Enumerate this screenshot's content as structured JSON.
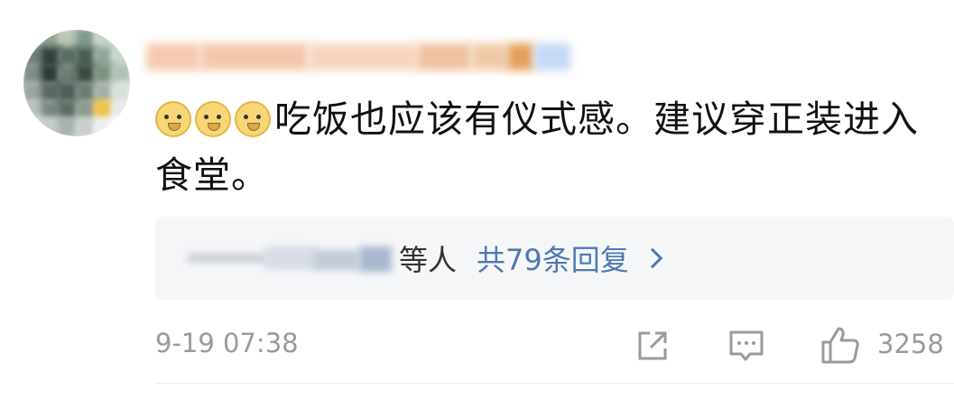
{
  "comment": {
    "emojis": [
      "doge-icon",
      "doge-icon",
      "doge-icon"
    ],
    "text": "吃饭也应该有仪式感。建议穿正装进入食堂。"
  },
  "replies": {
    "suffix": "等人",
    "count_label": "共79条回复"
  },
  "meta": {
    "timestamp": "9-19 07:38",
    "like_count": "3258"
  },
  "colors": {
    "link": "#4e79b0",
    "muted": "#9a9a9a",
    "reply_bg": "#f5f6f8"
  }
}
